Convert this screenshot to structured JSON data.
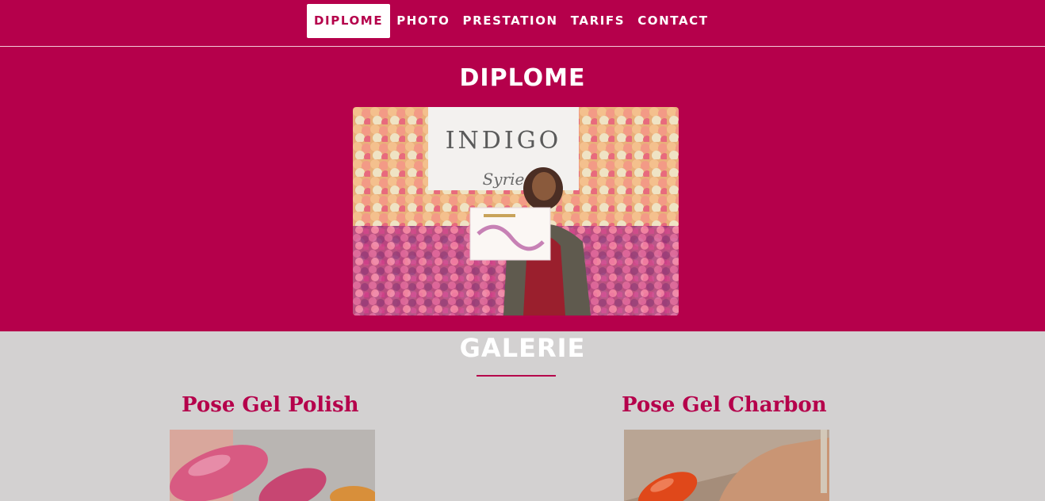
{
  "nav": {
    "items": [
      {
        "label": "DIPLOME",
        "active": true
      },
      {
        "label": "PHOTO",
        "active": false
      },
      {
        "label": "PRESTATION",
        "active": false
      },
      {
        "label": "TARIFS",
        "active": false
      },
      {
        "label": "CONTACT",
        "active": false
      }
    ]
  },
  "hero": {
    "title": "DIPLOME",
    "photo_alt": "diploma-photo"
  },
  "gallery": {
    "title": "GALERIE",
    "cards": [
      {
        "title": "Pose Gel Polish"
      },
      {
        "title": "Pose Gel Charbon"
      }
    ]
  },
  "colors": {
    "brand": "#b5004b",
    "gallery_bg": "#d3d1d1",
    "text_light": "#ffffff"
  }
}
